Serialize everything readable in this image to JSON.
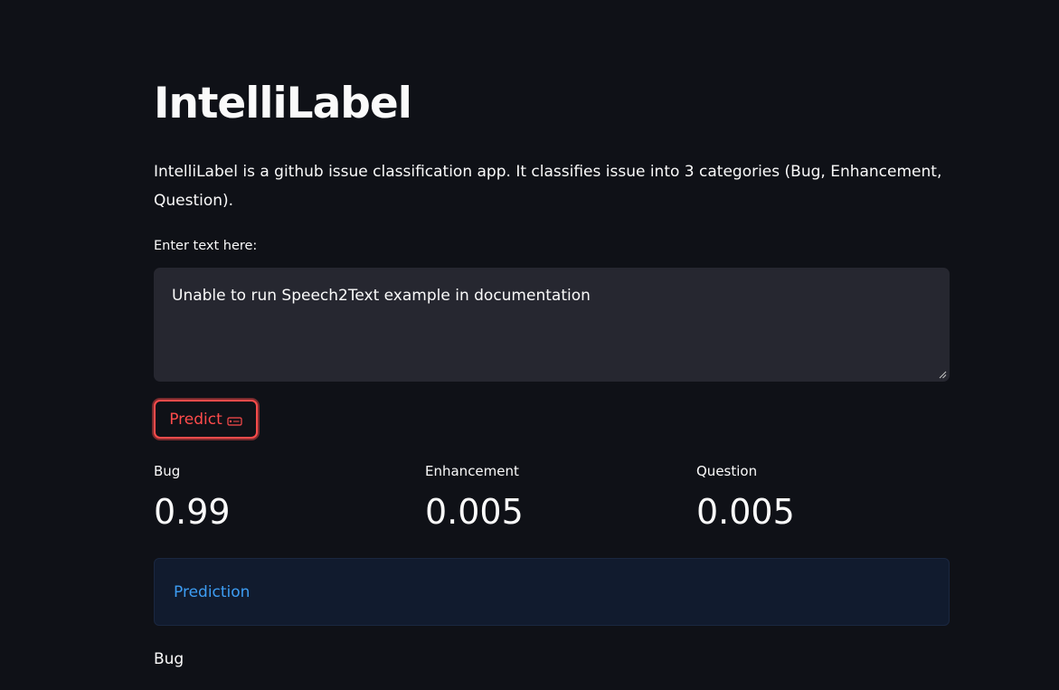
{
  "app": {
    "title": "IntelliLabel",
    "description": "IntelliLabel is a github issue classification app. It classifies issue into 3 categories (Bug, Enhancement, Question)."
  },
  "input": {
    "label": "Enter text here:",
    "value": "Unable to run Speech2Text example in documentation"
  },
  "predict_button": {
    "label": "Predict",
    "icon": "tag-icon",
    "accent_color": "#ff4b4b"
  },
  "metrics": [
    {
      "label": "Bug",
      "value": "0.99"
    },
    {
      "label": "Enhancement",
      "value": "0.005"
    },
    {
      "label": "Question",
      "value": "0.005"
    }
  ],
  "prediction": {
    "header": "Prediction",
    "header_color": "#3d9df3",
    "result": "Bug"
  },
  "colors": {
    "background": "#0f1117",
    "text": "#fafafa",
    "input_background": "#262730",
    "info_background": "#111b2e"
  }
}
